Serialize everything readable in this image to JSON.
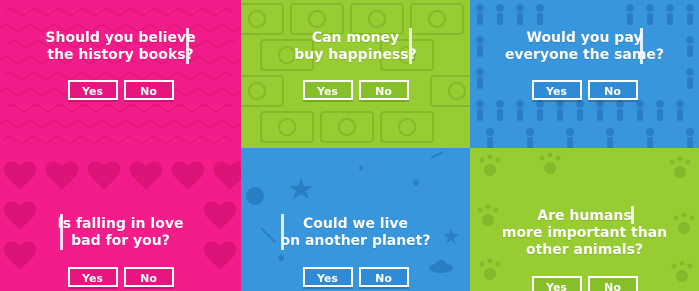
{
  "colors": {
    "pink": "#f21d8a",
    "green": "#97cc33",
    "blue": "#3796dc",
    "white": "#ffffff"
  },
  "tiles": [
    {
      "theme": "pink",
      "pattern_icon": "handwriting-pattern",
      "question_lines": [
        "Should you believe",
        "the history books?"
      ],
      "yes_label": "Yes",
      "no_label": "No"
    },
    {
      "theme": "green",
      "pattern_icon": "banknote-pattern",
      "question_lines": [
        "Can money",
        "buy happiness?"
      ],
      "yes_label": "Yes",
      "no_label": "No"
    },
    {
      "theme": "blue",
      "pattern_icon": "people-pattern",
      "question_lines": [
        "Would you pay",
        "everyone the same?"
      ],
      "yes_label": "Yes",
      "no_label": "No"
    },
    {
      "theme": "pink",
      "pattern_icon": "heart-pattern",
      "question_lines": [
        "Is falling in love",
        "bad for you?"
      ],
      "yes_label": "Yes",
      "no_label": "No"
    },
    {
      "theme": "blue",
      "pattern_icon": "space-pattern",
      "question_lines": [
        "Could we live",
        "on another planet?"
      ],
      "yes_label": "Yes",
      "no_label": "No"
    },
    {
      "theme": "green",
      "pattern_icon": "paw-print-pattern",
      "question_lines": [
        "Are humans",
        "more important than",
        "other animals?"
      ],
      "yes_label": "Yes",
      "no_label": "No"
    }
  ]
}
